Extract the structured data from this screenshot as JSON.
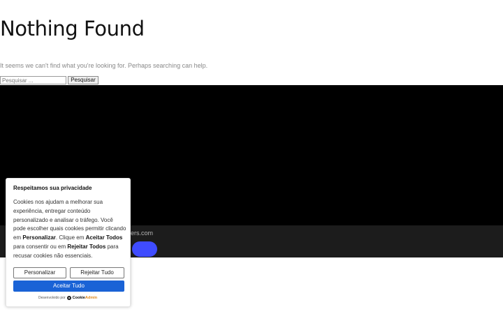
{
  "page": {
    "title": "Nothing Found",
    "subtitle": "It seems we can't find what you're looking for. Perhaps searching can help."
  },
  "search": {
    "placeholder": "Pesquisar ...",
    "value": "",
    "button_label": "Pesquisar"
  },
  "footer": {
    "text": "ers.com"
  },
  "cookie_banner": {
    "title": "Respeitamos sua privacidade",
    "body_parts": [
      "Cookies nos ajudam a melhorar sua experiência, entregar conteúdo personalizado e analisar o tráfego. Você pode escolher quais cookies permitir clicando em ",
      "Personalizar",
      ". Clique em ",
      "Aceitar Todos",
      " para consentir ou em ",
      "Rejeitar Todos",
      " para recusar cookies não essenciais."
    ],
    "customize_label": "Personalizar",
    "reject_label": "Rejeitar Tudo",
    "accept_label": "Aceitar Tudo",
    "powered_by": "Desenvolvido por",
    "brand_main": "Cookie",
    "brand_accent": "Admin"
  },
  "colors": {
    "accept_button": "#1a63d6",
    "footer_button": "#3f4cff",
    "video_background": "#000000"
  },
  "icons": {
    "brand_logo": "cookieadmin-logo-icon"
  }
}
